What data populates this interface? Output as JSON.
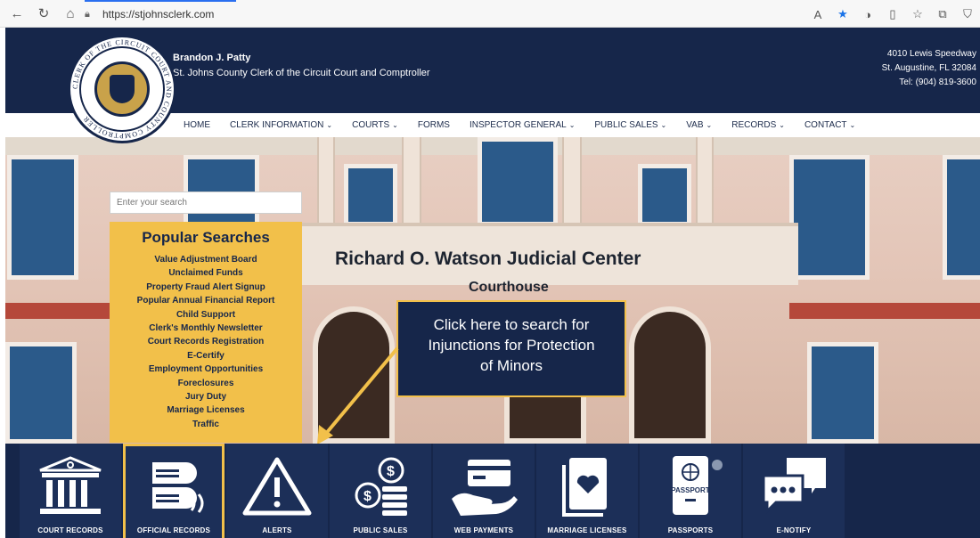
{
  "browser": {
    "url": "https://stjohnsclerk.com"
  },
  "header": {
    "clerk_name": "Brandon J. Patty",
    "clerk_title": "St. Johns County Clerk of the Circuit Court and Comptroller",
    "address_line1": "4010 Lewis Speedway",
    "address_line2": "St. Augustine, FL 32084",
    "phone": "Tel: (904) 819-3600",
    "seal_text": "CLERK OF THE CIRCUIT COURT AND COUNTY COMPTROLLER"
  },
  "nav": {
    "items": [
      {
        "label": "HOME"
      },
      {
        "label": "CLERK INFORMATION"
      },
      {
        "label": "COURTS"
      },
      {
        "label": "FORMS"
      },
      {
        "label": "INSPECTOR GENERAL"
      },
      {
        "label": "PUBLIC SALES"
      },
      {
        "label": "VAB"
      },
      {
        "label": "RECORDS"
      },
      {
        "label": "CONTACT"
      }
    ]
  },
  "hero": {
    "title": "Richard O. Watson Judicial Center",
    "subtitle": "Courthouse"
  },
  "search": {
    "placeholder": "Enter your search"
  },
  "popular": {
    "title": "Popular Searches",
    "items": [
      "Value Adjustment Board",
      "Unclaimed Funds",
      "Property Fraud Alert Signup",
      "Popular Annual Financial Report",
      "Child Support",
      "Clerk's Monthly Newsletter",
      "Court Records Registration",
      "E-Certify",
      "Employment Opportunities",
      "Foreclosures",
      "Jury Duty",
      "Marriage Licenses",
      "Traffic"
    ]
  },
  "callout": {
    "line1": "Click here to search for",
    "line2": "Injunctions for Protection",
    "line3": "of Minors"
  },
  "tiles": [
    {
      "label": "COURT RECORDS",
      "icon": "courthouse-icon"
    },
    {
      "label": "OFFICIAL RECORDS",
      "icon": "book-stack-icon"
    },
    {
      "label": "ALERTS",
      "icon": "warning-icon"
    },
    {
      "label": "PUBLIC SALES",
      "icon": "coins-icon"
    },
    {
      "label": "WEB PAYMENTS",
      "icon": "card-hand-icon"
    },
    {
      "label": "MARRIAGE LICENSES",
      "icon": "heart-document-icon"
    },
    {
      "label": "PASSPORTS",
      "icon": "passport-icon",
      "icon_text": "PASSPORT"
    },
    {
      "label": "E-NOTIFY",
      "icon": "chat-bubbles-icon"
    }
  ],
  "colors": {
    "navy": "#16264a",
    "gold": "#f2c04a",
    "white": "#ffffff"
  }
}
